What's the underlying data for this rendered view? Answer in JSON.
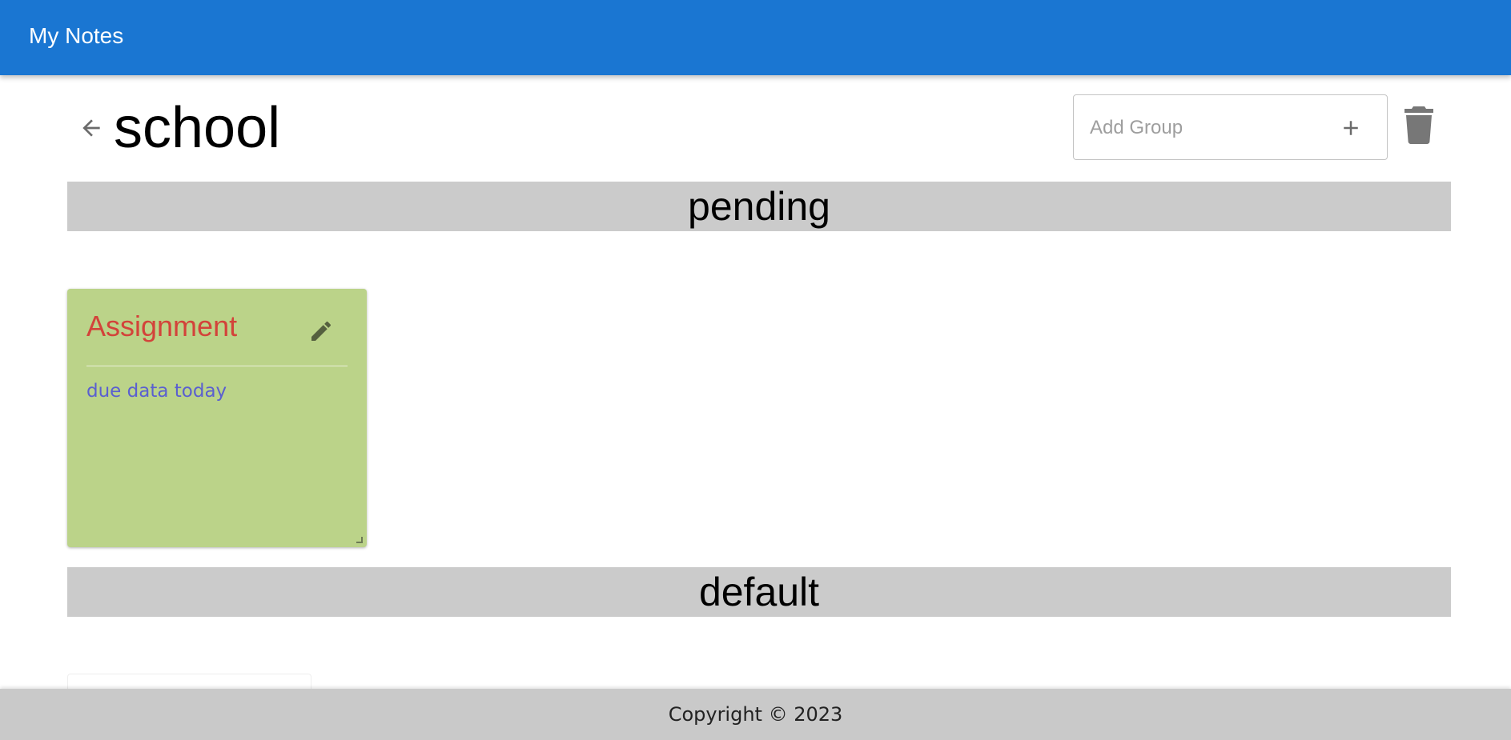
{
  "appbar": {
    "title": "My Notes",
    "color": "#1a76d2"
  },
  "page": {
    "title": "school",
    "back_icon": "arrow-left-icon",
    "add_group": {
      "placeholder": "Add Group",
      "value": "",
      "add_icon": "plus-icon"
    },
    "delete_icon": "trash-icon"
  },
  "groups": [
    {
      "name": "pending",
      "notes": [
        {
          "title": "Assignment",
          "body": "due data today",
          "color": "#bbd389",
          "title_color": "#d3433a",
          "body_color": "#5a5fd0",
          "edit_icon": "pencil-icon"
        }
      ]
    },
    {
      "name": "default",
      "notes": []
    }
  ],
  "footer": {
    "text": "Copyright © 2023"
  }
}
